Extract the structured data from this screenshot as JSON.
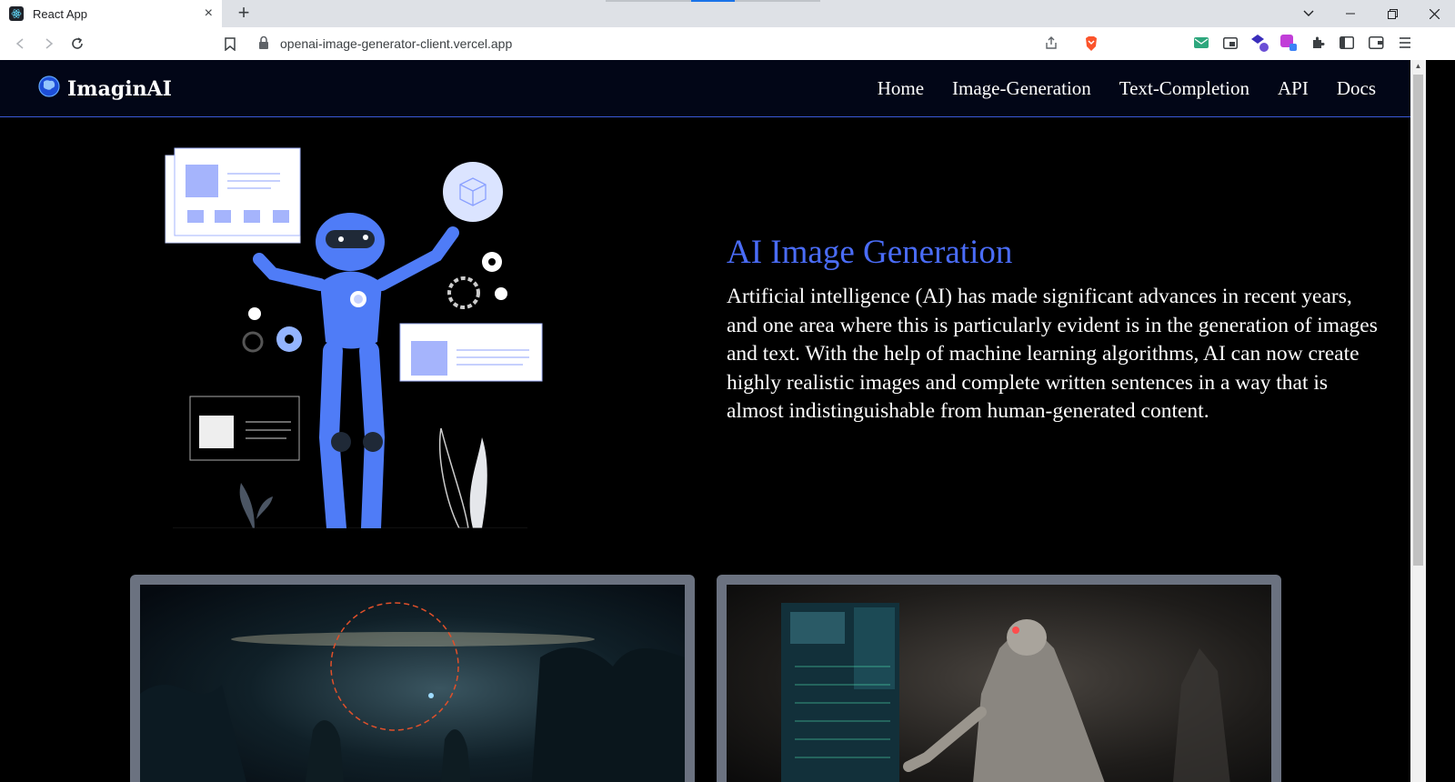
{
  "browser": {
    "tab_title": "React App",
    "url": "openai-image-generator-client.vercel.app",
    "new_tab_symbol": "+",
    "close_symbol": "×"
  },
  "site": {
    "brand": "ImaginAI",
    "nav": [
      "Home",
      "Image-Generation",
      "Text-Completion",
      "API",
      "Docs"
    ]
  },
  "hero": {
    "title": "AI Image Generation",
    "description": "Artificial intelligence (AI) has made significant advances in recent years, and one area where this is particularly evident is in the generation of images and text. With the help of machine learning algorithms, AI can now create highly realistic images and complete written sentences in a way that is almost indistinguishable from human-generated content."
  },
  "colors": {
    "accent": "#4a6cf7",
    "nav_bg": "#020617",
    "page_bg": "#000000",
    "card_frame": "#6b7280"
  },
  "icons": [
    "back-icon",
    "forward-icon",
    "reload-icon",
    "bookmark-icon",
    "lock-icon",
    "share-icon",
    "brave-shield-icon",
    "extensions-icon",
    "sidebar-icon",
    "wallet-icon",
    "menu-icon"
  ]
}
